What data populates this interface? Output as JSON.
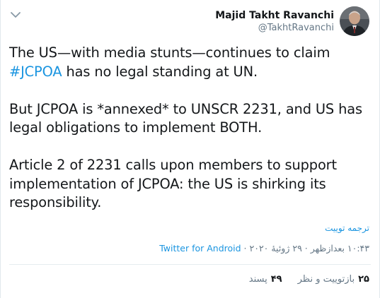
{
  "author": {
    "display_name": "Majid Takht Ravanchi",
    "handle": "@TakhtRavanchi"
  },
  "tweet": {
    "para1_pre": "The US—with media stunts—continues to claim ",
    "hashtag": "#JCPOA",
    "para1_post": " has no legal standing at UN.",
    "para2": "But JCPOA is *annexed* to UNSCR 2231, and US has legal obligations to implement BOTH.",
    "para3": "Article 2 of 2231 calls upon members to support implementation of JCPOA: the US is shirking its responsibility."
  },
  "translate_label": "ترجمه توییت",
  "meta": {
    "time": "۱۰:۴۳ بعدازظهر",
    "separator": "·",
    "date": "۲۹ ژوئیهٔ ۲۰۲۰",
    "source": "Twitter for Android"
  },
  "stats": {
    "retweets_count": "۲۵",
    "retweets_label": "بازتوییت و نظر",
    "likes_count": "۴۹",
    "likes_label": "پسند"
  },
  "colors": {
    "link": "#1b95e0",
    "text": "#14171a",
    "muted": "#657786",
    "divider": "#e6ecf0"
  },
  "icons": {
    "caret": "chevron-down-icon",
    "avatar": "avatar"
  }
}
